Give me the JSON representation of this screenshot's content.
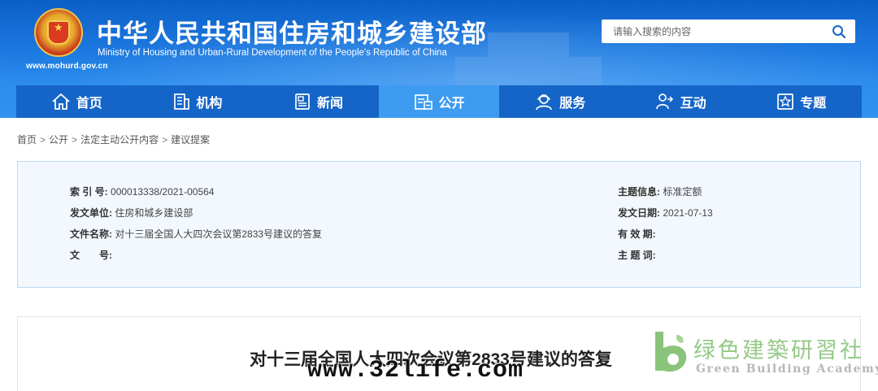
{
  "header": {
    "site_title": "中华人民共和国住房和城乡建设部",
    "site_subtitle": "Ministry of Housing and Urban-Rural Development of the People's Republic of China",
    "site_url": "www.mohurd.gov.cn",
    "emblem_icon": "national-emblem-icon"
  },
  "search": {
    "placeholder": "请输入搜索的内容",
    "button_icon": "search-icon"
  },
  "nav": {
    "items": [
      {
        "label": "首页",
        "icon": "home-icon",
        "active": false
      },
      {
        "label": "机构",
        "icon": "building-icon",
        "active": false
      },
      {
        "label": "新闻",
        "icon": "news-icon",
        "active": false
      },
      {
        "label": "公开",
        "icon": "document-icon",
        "active": true
      },
      {
        "label": "服务",
        "icon": "service-icon",
        "active": false
      },
      {
        "label": "互动",
        "icon": "interaction-icon",
        "active": false
      },
      {
        "label": "专题",
        "icon": "topic-icon",
        "active": false
      }
    ]
  },
  "breadcrumb": {
    "items": [
      "首页",
      "公开",
      "法定主动公开内容",
      "建议提案"
    ],
    "separator": ">"
  },
  "info": {
    "index_label": "索 引 号:",
    "index_value": "000013338/2021-00564",
    "issuer_label": "发文单位:",
    "issuer_value": "住房和城乡建设部",
    "doc_name_label": "文件名称:",
    "doc_name_value": "对十三届全国人大四次会议第2833号建议的答复",
    "doc_no_label": "文　　号:",
    "doc_no_value": "",
    "topic_label": "主题信息:",
    "topic_value": "标准定额",
    "date_label": "发文日期:",
    "date_value": "2021-07-13",
    "validity_label": "有 效 期:",
    "validity_value": "",
    "keywords_label": "主 题 词:",
    "keywords_value": ""
  },
  "document": {
    "title": "对十三届全国人大四次会议第2833号建议的答复"
  },
  "watermarks": {
    "url": "www.32life.com",
    "academy_cn": "绿色建築研習社",
    "academy_en": "Green Building Academy"
  },
  "colors": {
    "header_blue": "#1d7ae0",
    "nav_blue": "#1565c8",
    "nav_active": "#3d9bf0",
    "info_bg": "#f2f8fd",
    "logo_green": "#8ac47a"
  }
}
